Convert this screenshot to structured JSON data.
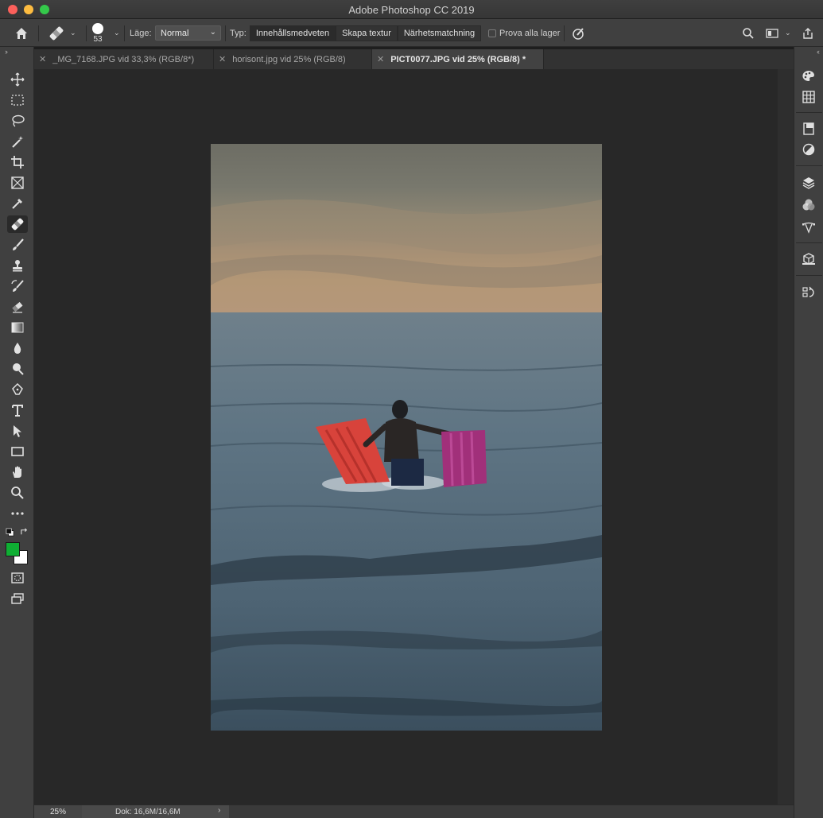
{
  "window": {
    "title": "Adobe Photoshop CC 2019"
  },
  "options_bar": {
    "brush_size": "53",
    "mode_label": "Läge:",
    "mode_value": "Normal",
    "type_label": "Typ:",
    "type_options": [
      "Innehållsmedveten",
      "Skapa textur",
      "Närhetsmatchning"
    ],
    "active_type": "Innehållsmedveten",
    "sample_all_label": "Prova alla lager",
    "sample_all_checked": false
  },
  "tabs": [
    {
      "label": "_MG_7168.JPG vid 33,3% (RGB/8*)",
      "active": false
    },
    {
      "label": "horisont.jpg vid 25% (RGB/8)",
      "active": false
    },
    {
      "label": "PICT0077.JPG vid 25% (RGB/8) *",
      "active": true
    }
  ],
  "toolbar": {
    "active_tool": "spot-healing-brush",
    "foreground_color": "#0fae33",
    "background_color": "#ffffff"
  },
  "status": {
    "zoom": "25%",
    "doc_info": "Dok: 16,6M/16,6M"
  }
}
